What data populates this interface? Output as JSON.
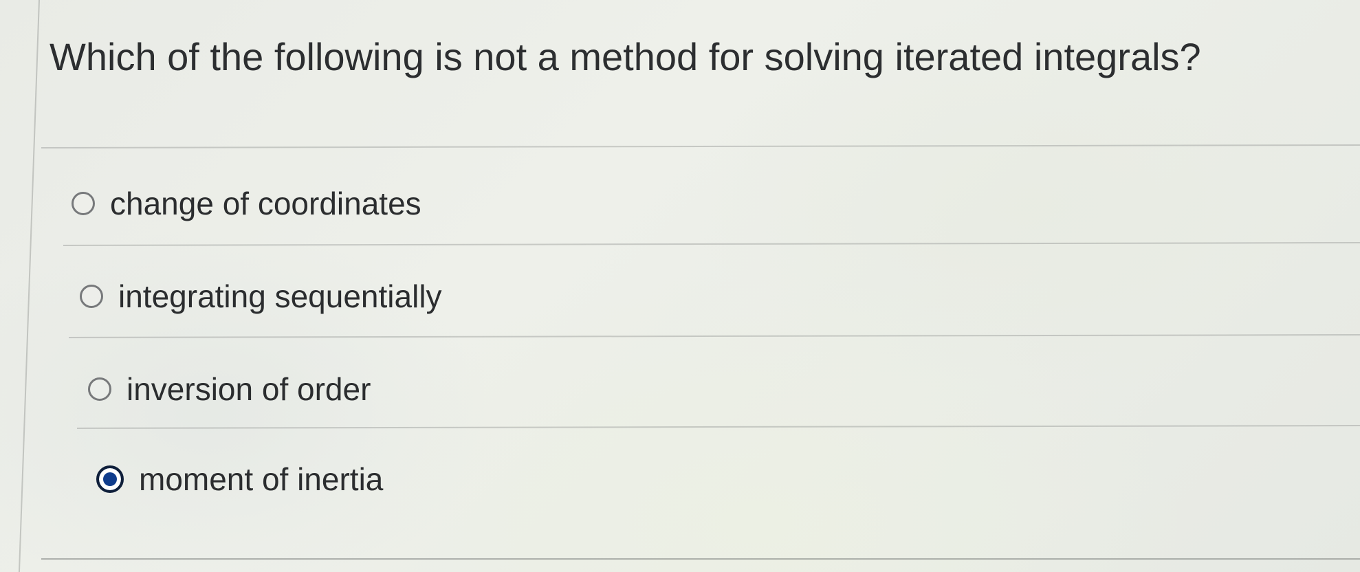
{
  "question": {
    "text": "Which of the following is not a method for solving iterated integrals?"
  },
  "options": [
    {
      "label": "change of coordinates",
      "selected": false
    },
    {
      "label": "integrating sequentially",
      "selected": false
    },
    {
      "label": "inversion of order",
      "selected": false
    },
    {
      "label": "moment of inertia",
      "selected": true
    }
  ],
  "colors": {
    "selected_radio": "#0f3c8c",
    "text": "#2b2d2f"
  }
}
